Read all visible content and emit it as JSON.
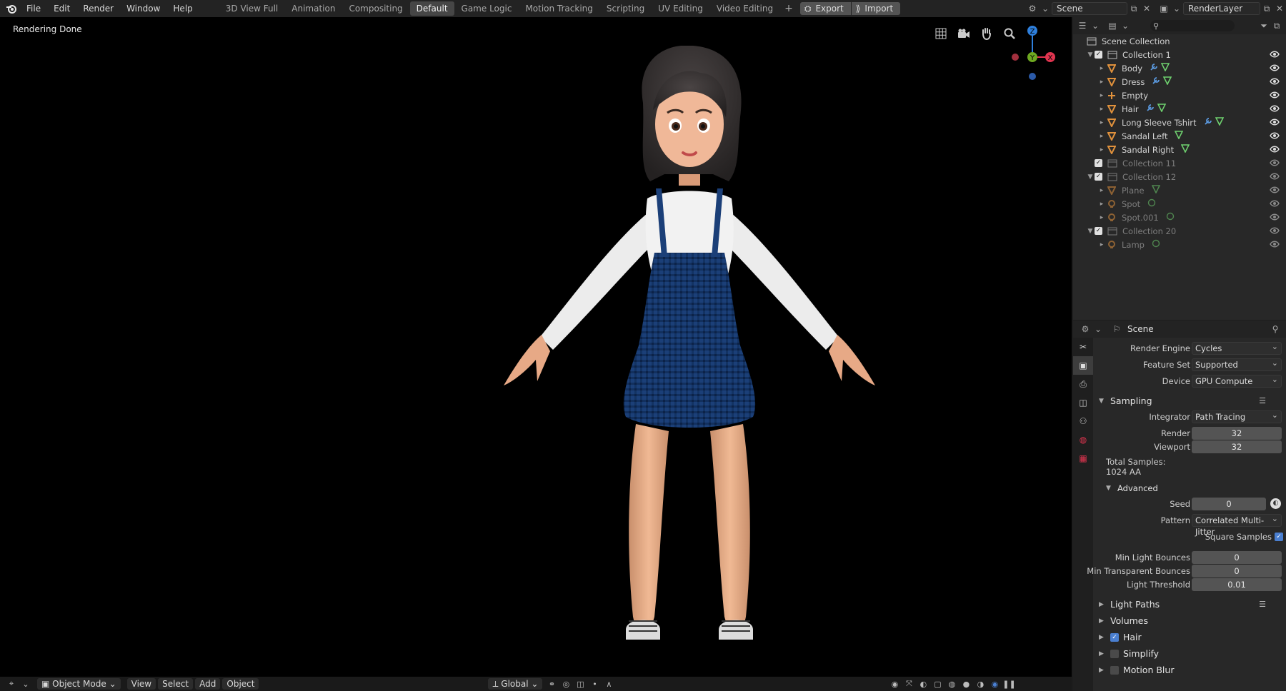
{
  "menu": [
    "File",
    "Edit",
    "Render",
    "Window",
    "Help"
  ],
  "workspaces": [
    "3D View Full",
    "Animation",
    "Compositing",
    "Default",
    "Game Logic",
    "Motion Tracking",
    "Scripting",
    "UV Editing",
    "Video Editing"
  ],
  "active_workspace": "Default",
  "export_label": "Export",
  "import_label": "Import",
  "scene_name": "Scene",
  "render_layer": "RenderLayer",
  "viewport": {
    "status": "Rendering Done",
    "gizmo": {
      "z": "Z",
      "y": "Y",
      "x": "X"
    }
  },
  "footer": {
    "mode": "Object Mode",
    "view": "View",
    "select": "Select",
    "add": "Add",
    "object": "Object",
    "transform": "Global"
  },
  "outliner": {
    "root": "Scene Collection",
    "rows": [
      {
        "label": "Collection 1",
        "type": "collection",
        "depth": 1,
        "expanded": true,
        "checked": true,
        "dim": false
      },
      {
        "label": "Body",
        "type": "mesh",
        "depth": 2,
        "mods": [
          "wrench",
          "mesh-data"
        ],
        "dim": false
      },
      {
        "label": "Dress",
        "type": "mesh",
        "depth": 2,
        "mods": [
          "wrench",
          "mesh-data"
        ],
        "dim": false
      },
      {
        "label": "Empty",
        "type": "empty",
        "depth": 2,
        "mods": [],
        "dim": false
      },
      {
        "label": "Hair",
        "type": "mesh",
        "depth": 2,
        "mods": [
          "wrench",
          "mesh-data"
        ],
        "dim": false
      },
      {
        "label": "Long Sleeve Tshirt",
        "type": "mesh",
        "depth": 2,
        "mods": [
          "wrench",
          "mesh-data"
        ],
        "dim": false
      },
      {
        "label": "Sandal Left",
        "type": "mesh",
        "depth": 2,
        "mods": [
          "mesh-data"
        ],
        "dim": false
      },
      {
        "label": "Sandal Right",
        "type": "mesh",
        "depth": 2,
        "mods": [
          "mesh-data"
        ],
        "dim": false
      },
      {
        "label": "Collection 11",
        "type": "collection",
        "depth": 1,
        "expanded": false,
        "checked": true,
        "dim": true
      },
      {
        "label": "Collection 12",
        "type": "collection",
        "depth": 1,
        "expanded": true,
        "checked": true,
        "dim": true
      },
      {
        "label": "Plane",
        "type": "mesh",
        "depth": 2,
        "mods": [
          "mesh-data"
        ],
        "dim": true
      },
      {
        "label": "Spot",
        "type": "light",
        "depth": 2,
        "mods": [
          "light-data"
        ],
        "dim": true
      },
      {
        "label": "Spot.001",
        "type": "light",
        "depth": 2,
        "mods": [
          "light-data"
        ],
        "dim": true
      },
      {
        "label": "Collection 20",
        "type": "collection",
        "depth": 1,
        "expanded": true,
        "checked": true,
        "dim": true
      },
      {
        "label": "Lamp",
        "type": "light",
        "depth": 2,
        "mods": [
          "light-data"
        ],
        "dim": true
      }
    ]
  },
  "properties": {
    "context": "Scene",
    "render_engine_label": "Render Engine",
    "render_engine": "Cycles",
    "feature_set_label": "Feature Set",
    "feature_set": "Supported",
    "device_label": "Device",
    "device": "GPU Compute",
    "sampling": "Sampling",
    "integrator_label": "Integrator",
    "integrator": "Path Tracing",
    "render_label": "Render",
    "render_samples": "32",
    "viewport_label": "Viewport",
    "viewport_samples": "32",
    "total_samples_label": "Total Samples:",
    "total_samples": "1024 AA",
    "advanced": "Advanced",
    "seed_label": "Seed",
    "seed": "0",
    "pattern_label": "Pattern",
    "pattern": "Correlated Multi-Jitter",
    "square_samples": "Square Samples",
    "min_light_bounces_label": "Min Light Bounces",
    "min_light_bounces": "0",
    "min_transparent_bounces_label": "Min Transparent Bounces",
    "min_transparent_bounces": "0",
    "light_threshold_label": "Light Threshold",
    "light_threshold": "0.01",
    "light_paths": "Light Paths",
    "volumes": "Volumes",
    "hair": "Hair",
    "simplify": "Simplify",
    "motion_blur": "Motion Blur"
  },
  "colors": {
    "accent": "#4a7fd0",
    "axis_x": "#e0344f",
    "axis_y": "#6ea821",
    "axis_z": "#2e7fdc",
    "mesh_icon": "#e0913c",
    "data_icon": "#6fd16f"
  }
}
